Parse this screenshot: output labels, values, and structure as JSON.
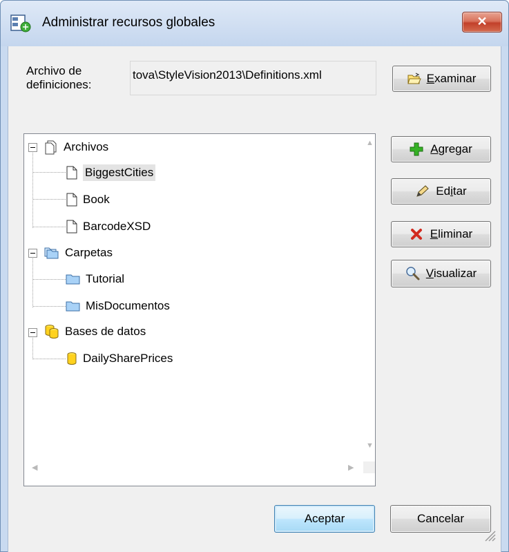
{
  "window": {
    "title": "Administrar recursos globales",
    "close_label": "✕"
  },
  "definitions": {
    "label": "Archivo de definiciones:",
    "value": "tova\\StyleVision2013\\Definitions.xml"
  },
  "buttons": {
    "examinar": {
      "pre": "",
      "underline": "E",
      "post": "xaminar"
    },
    "agregar": {
      "pre": "",
      "underline": "A",
      "post": "gregar"
    },
    "editar": {
      "pre": "Ed",
      "underline": "i",
      "post": "tar"
    },
    "eliminar": {
      "pre": "",
      "underline": "E",
      "post": "liminar"
    },
    "visualizar": {
      "pre": "",
      "underline": "V",
      "post": "isualizar"
    },
    "aceptar": "Aceptar",
    "cancelar": "Cancelar"
  },
  "tree": {
    "archivos": {
      "label": "Archivos",
      "items": [
        "BiggestCities",
        "Book",
        "BarcodeXSD"
      ],
      "selected": "BiggestCities"
    },
    "carpetas": {
      "label": "Carpetas",
      "items": [
        "Tutorial",
        "MisDocumentos"
      ]
    },
    "bases": {
      "label": "Bases de datos",
      "items": [
        "DailySharePrices"
      ]
    }
  },
  "colors": {
    "selection": "#e3e3e3",
    "window_frame": "#c9daf0",
    "close_red": "#c2402a"
  }
}
